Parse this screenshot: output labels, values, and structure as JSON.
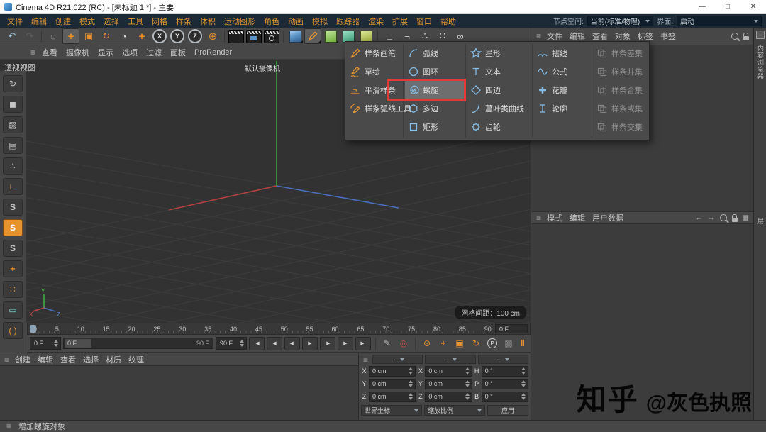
{
  "window": {
    "title": "Cinema 4D R21.022 (RC) - [未标题 1 *] - 主要",
    "minimize": "—",
    "maximize": "□",
    "close": "✕"
  },
  "menubar": {
    "items": [
      "文件",
      "编辑",
      "创建",
      "模式",
      "选择",
      "工具",
      "网格",
      "样条",
      "体积",
      "运动图形",
      "角色",
      "动画",
      "模拟",
      "跟踪器",
      "渲染",
      "扩展",
      "窗口",
      "帮助"
    ],
    "node_space_label": "节点空间:",
    "node_space_value": "当前(标准/物理)",
    "interface_label": "界面:",
    "interface_value": "启动"
  },
  "toolbar": {
    "x": "X",
    "y": "Y",
    "z": "Z"
  },
  "icons": {
    "hamburger": "≡",
    "undo": "↶",
    "redo": "↷",
    "live_selection": "◌",
    "move": "+",
    "scale": "▣",
    "rotate": "↻",
    "history": "◔",
    "add": "+",
    "coord_system": "⊕",
    "workplane_l": "∟",
    "workplane_r": "¬",
    "snap_points": "∴",
    "snap_grid": "∷",
    "quantize": "∞",
    "back": "←",
    "forward": "→",
    "grid": "▦",
    "tp_start": "|◀",
    "tp_prev_key": "◀",
    "tp_prev": "◀|",
    "tp_play": "▶",
    "tp_next": "|▶",
    "tp_next_key": "▶",
    "tp_end": "▶|",
    "record_key": "✎",
    "autokey": "◎",
    "key_selection": "⊙",
    "rec_position": "+",
    "rec_scale": "▣",
    "rec_rotation": "↻",
    "pla": "▩",
    "cache": "‖"
  },
  "palette": {
    "solo": "S"
  },
  "viewport": {
    "menu_items": [
      "查看",
      "摄像机",
      "显示",
      "选项",
      "过滤",
      "面板",
      "ProRender"
    ],
    "view_label": "透视视图",
    "camera_label": "默认摄像机",
    "grid_spacing": "网格间距：100 cm",
    "axis_x": "X",
    "axis_y": "Y",
    "axis_z": "Z"
  },
  "spline_menu": {
    "tools": [
      "样条画笔",
      "草绘",
      "平滑样条",
      "样条弧线工具"
    ],
    "col1": [
      "弧线",
      "圆环",
      "螺旋",
      "多边",
      "矩形"
    ],
    "col2": [
      "星形",
      "文本",
      "四边",
      "蔓叶类曲线",
      "齿轮"
    ],
    "col3": [
      "摆线",
      "公式",
      "花瓣",
      "轮廓"
    ],
    "booleans": [
      "样条差集",
      "样条并集",
      "样条合集",
      "样条或集",
      "样条交集"
    ]
  },
  "object_manager": {
    "menu_items": [
      "文件",
      "编辑",
      "查看",
      "对象",
      "标签",
      "书签"
    ]
  },
  "attribute_manager": {
    "menu_items": [
      "模式",
      "编辑",
      "用户数据"
    ]
  },
  "right_tabs": {
    "tab1": "内容浏览器",
    "tab2": "层"
  },
  "timeline": {
    "ticks": [
      "0",
      "5",
      "10",
      "15",
      "20",
      "25",
      "30",
      "35",
      "40",
      "45",
      "50",
      "55",
      "60",
      "65",
      "70",
      "75",
      "80",
      "85",
      "90"
    ],
    "current": "0 F"
  },
  "transport": {
    "frame": "0 F",
    "range_start": "0 F",
    "range_end": "90 F",
    "end_frame": "90 F",
    "parameter": "P"
  },
  "material_manager": {
    "menu_items": [
      "创建",
      "编辑",
      "查看",
      "选择",
      "材质",
      "纹理"
    ]
  },
  "coordinates": {
    "headers": [
      "--",
      "--",
      "--"
    ],
    "rows": [
      {
        "l1": "X",
        "v1": "0 cm",
        "l2": "X",
        "v2": "0 cm",
        "l3": "H",
        "v3": "0 °"
      },
      {
        "l1": "Y",
        "v1": "0 cm",
        "l2": "Y",
        "v2": "0 cm",
        "l3": "P",
        "v3": "0 °"
      },
      {
        "l1": "Z",
        "v1": "0 cm",
        "l2": "Z",
        "v2": "0 cm",
        "l3": "B",
        "v3": "0 °"
      }
    ],
    "system": "世界坐标",
    "mode": "缩放比例",
    "apply": "应用"
  },
  "statusbar": {
    "message": "增加螺旋对象"
  },
  "watermark": {
    "brand": "知乎",
    "handle": "@灰色执照"
  }
}
